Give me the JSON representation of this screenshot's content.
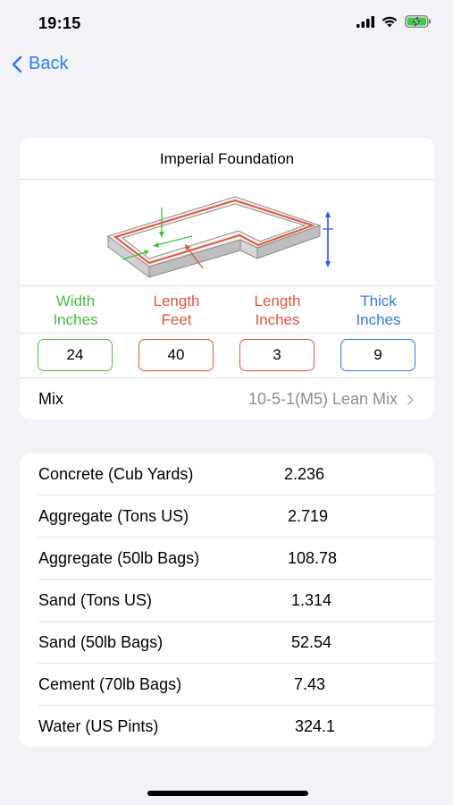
{
  "status_bar": {
    "time": "19:15"
  },
  "nav": {
    "back_label": "Back"
  },
  "foundation": {
    "title": "Imperial Foundation",
    "columns": [
      {
        "line1": "Width",
        "line2": "Inches",
        "value": "24",
        "color": "#4cbb45"
      },
      {
        "line1": "Length",
        "line2": "Feet",
        "value": "40",
        "color": "#e0553f"
      },
      {
        "line1": "Length",
        "line2": "Inches",
        "value": "3",
        "color": "#e0553f"
      },
      {
        "line1": "Thick",
        "line2": "Inches",
        "value": "9",
        "color": "#3277e4"
      }
    ],
    "mix_label": "Mix",
    "mix_value": "10-5-1(M5) Lean Mix"
  },
  "results": [
    {
      "label": "Concrete (Cub Yards)",
      "value": "2.236"
    },
    {
      "label": "Aggregate (Tons US)",
      "value": "2.719"
    },
    {
      "label": "Aggregate (50lb Bags)",
      "value": "108.78"
    },
    {
      "label": "Sand (Tons US)",
      "value": "1.314"
    },
    {
      "label": "Sand (50lb Bags)",
      "value": "52.54"
    },
    {
      "label": "Cement (70lb Bags)",
      "value": "7.43"
    },
    {
      "label": "Water (US Pints)",
      "value": "324.1"
    }
  ]
}
